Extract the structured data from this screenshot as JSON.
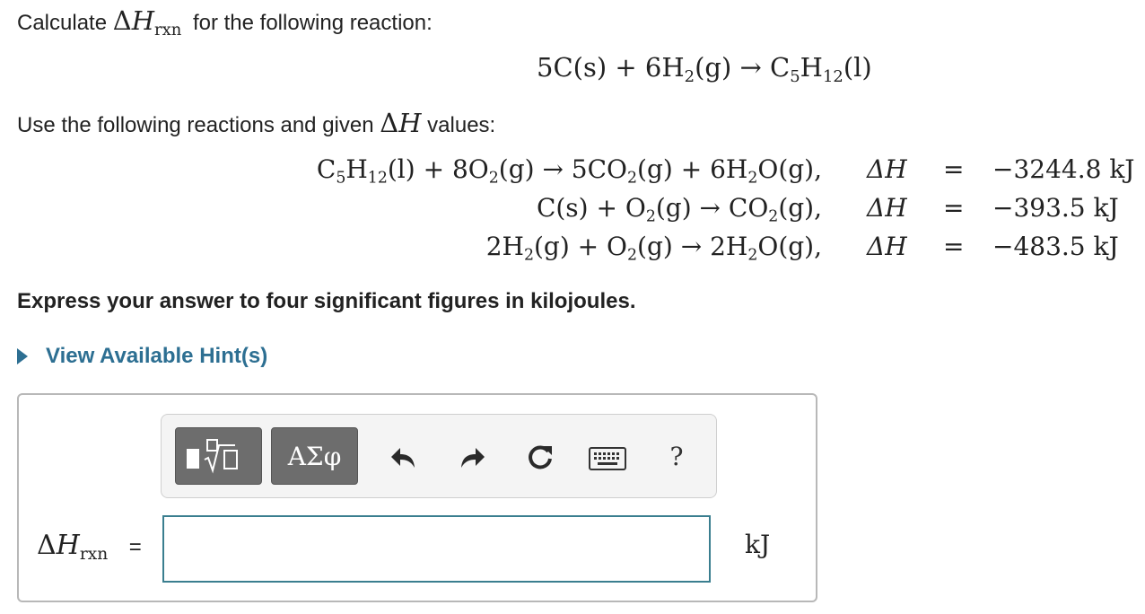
{
  "question": {
    "prompt_prefix": "Calculate",
    "prompt_suffix": "for the following reaction:",
    "delta": "Δ",
    "H": "H",
    "rxn_sub": "rxn",
    "target_reaction": {
      "lhs1": "5C(s) + 6H",
      "lhs1_sub": "2",
      "lhs2": "(g) → C",
      "rhs_sub1": "5",
      "rhs_mid": "H",
      "rhs_sub2": "12",
      "rhs_end": "(l)"
    },
    "use_text_prefix": "Use the following reactions and given",
    "use_text_suffix": "values:",
    "reactions": [
      {
        "equation_html_parts": [
          "C",
          "5",
          "H",
          "12",
          "(l) + 8O",
          "2",
          "(g) → 5CO",
          "2",
          "(g) + 6H",
          "2",
          "O(g),"
        ],
        "dh_label": "ΔH",
        "equals": "=",
        "value": "−3244.8 kJ"
      },
      {
        "equation_html_parts": [
          "C(s) + O",
          "2",
          "(g) → CO",
          "2",
          "(g),"
        ],
        "dh_label": "ΔH",
        "equals": "=",
        "value": "−393.5 kJ"
      },
      {
        "equation_html_parts": [
          "2H",
          "2",
          "(g) + O",
          "2",
          "(g) → 2H",
          "2",
          "O(g),"
        ],
        "dh_label": "ΔH",
        "equals": "=",
        "value": "−483.5 kJ"
      }
    ],
    "instructions": "Express your answer to four significant figures in kilojoules.",
    "hint_link": "View Available Hint(s)"
  },
  "toolbar": {
    "template_icon": "square-root-template-icon",
    "greek_button_label": "ΑΣφ",
    "undo_icon": "undo-icon",
    "redo_icon": "redo-icon",
    "reset_icon": "reset-icon",
    "keyboard_icon": "keyboard-icon",
    "help_label": "?"
  },
  "answer": {
    "label_delta": "Δ",
    "label_H": "H",
    "label_sub": "rxn",
    "label_equals": "=",
    "input_value": "",
    "unit": "kJ"
  },
  "colors": {
    "hint_blue": "#2d6f92",
    "input_border": "#3a7e8f",
    "toolbar_button": "#6d6d6d"
  }
}
